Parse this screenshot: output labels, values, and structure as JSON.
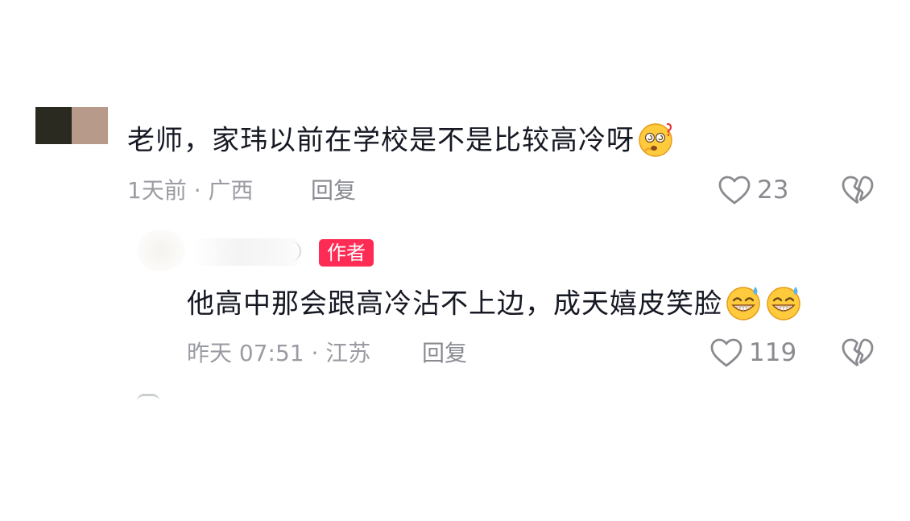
{
  "comments": [
    {
      "text": "老师，家玮以前在学校是不是比较高冷呀",
      "emoji": "thinking-dizzy-emoji",
      "meta": "1天前 · 广西",
      "reply_label": "回复",
      "likes": "23"
    }
  ],
  "reply": {
    "badge": "作者",
    "text": "他高中那会跟高冷沾不上边，成天嬉皮笑脸",
    "emoji": "grinning-sweat-emoji",
    "meta": "昨天 07:51 · 江苏",
    "reply_label": "回复",
    "likes": "119"
  },
  "colors": {
    "badge_bg": "#fe2c55",
    "meta_text": "#9b9ca3",
    "body_text": "#161823"
  }
}
